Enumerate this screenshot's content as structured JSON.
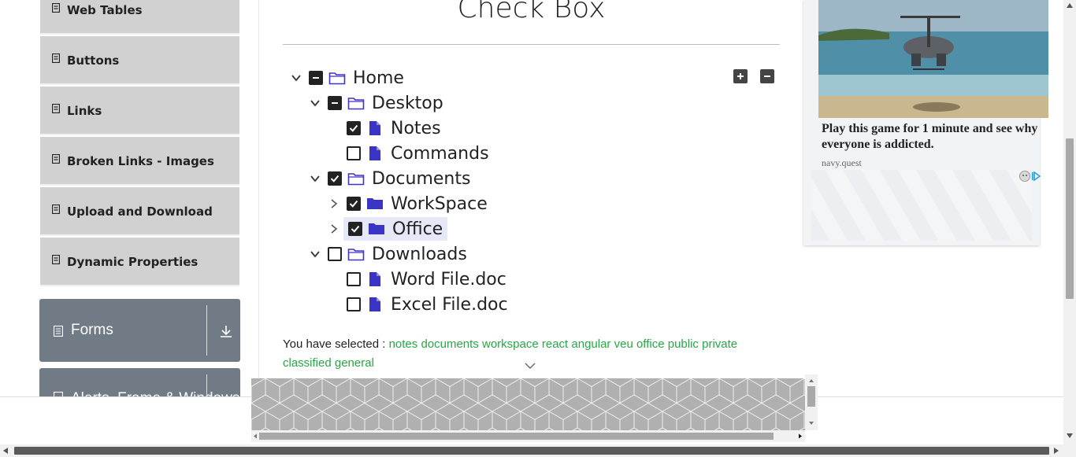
{
  "sidebar": {
    "items": [
      {
        "label": "Web Tables"
      },
      {
        "label": "Buttons"
      },
      {
        "label": "Links"
      },
      {
        "label": "Broken Links - Images"
      },
      {
        "label": "Upload and Download"
      },
      {
        "label": "Dynamic Properties"
      }
    ],
    "groups": [
      {
        "label": "Forms"
      },
      {
        "label": "Alerts, Frame & Windows"
      }
    ]
  },
  "main": {
    "title": "Check Box",
    "tree": [
      {
        "label": "Home",
        "state": "half",
        "expanded": true,
        "type": "folder-open"
      },
      {
        "label": "Desktop",
        "state": "half",
        "expanded": true,
        "type": "folder-open"
      },
      {
        "label": "Notes",
        "state": "checked",
        "type": "file"
      },
      {
        "label": "Commands",
        "state": "unchecked",
        "type": "file"
      },
      {
        "label": "Documents",
        "state": "checked",
        "expanded": true,
        "type": "folder-open"
      },
      {
        "label": "WorkSpace",
        "state": "checked",
        "expanded": false,
        "type": "folder-closed"
      },
      {
        "label": "Office",
        "state": "checked",
        "expanded": false,
        "type": "folder-closed",
        "highlighted": true
      },
      {
        "label": "Downloads",
        "state": "unchecked",
        "expanded": true,
        "type": "folder-open"
      },
      {
        "label": "Word File.doc",
        "state": "unchecked",
        "type": "file"
      },
      {
        "label": "Excel File.doc",
        "state": "unchecked",
        "type": "file"
      }
    ],
    "result_prefix": "You have selected :",
    "selected": [
      "notes",
      "documents",
      "workspace",
      "react",
      "angular",
      "veu",
      "office",
      "public",
      "private",
      "classified",
      "general"
    ]
  },
  "ad": {
    "headline": "Play this game for 1 minute and see why everyone is addicted.",
    "source": "navy.quest"
  },
  "colors": {
    "accent": "#3b35c6",
    "selected_text": "#28a745",
    "sidebar_item_bg": "#d1d1d1",
    "group_bg": "#717b85"
  }
}
